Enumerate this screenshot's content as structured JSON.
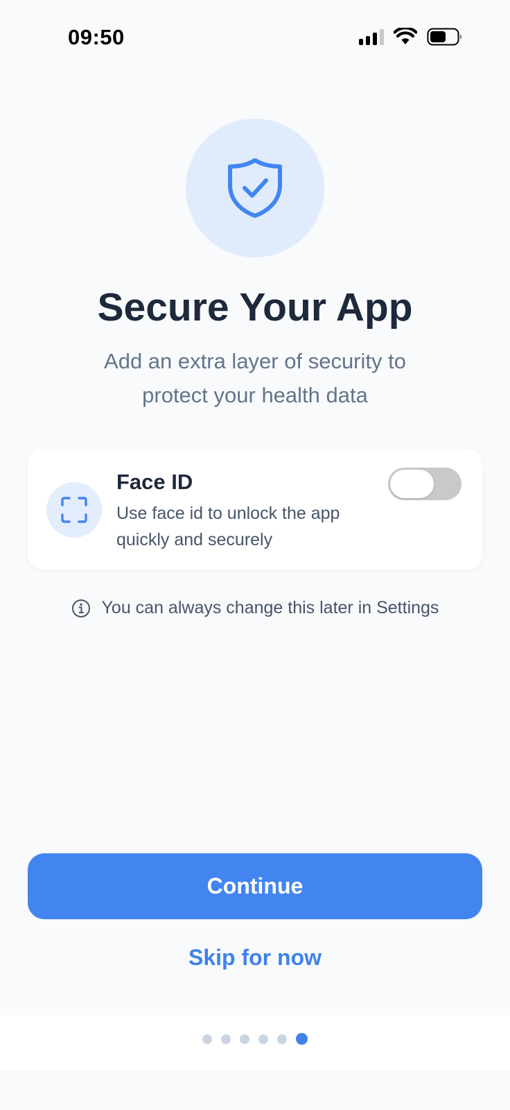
{
  "status_bar": {
    "time": "09:50",
    "icons": [
      "signal-icon",
      "wifi-icon",
      "battery-icon"
    ]
  },
  "hero": {
    "icon": "shield-check-icon",
    "title": "Secure Your App",
    "subtitle": "Add an extra layer of security to protect your health data"
  },
  "face_id_card": {
    "icon": "face-id-icon",
    "title": "Face ID",
    "description": "Use face id to unlock the app quickly and securely",
    "toggle_on": false
  },
  "info": {
    "icon": "info-icon",
    "text": "You can always change this later in Settings"
  },
  "actions": {
    "continue_label": "Continue",
    "skip_label": "Skip for now"
  },
  "pager": {
    "total": 6,
    "active_index": 5
  },
  "colors": {
    "accent": "#4285F0",
    "background": "#F8FAFC",
    "title": "#1E293B",
    "muted": "#64748B"
  }
}
